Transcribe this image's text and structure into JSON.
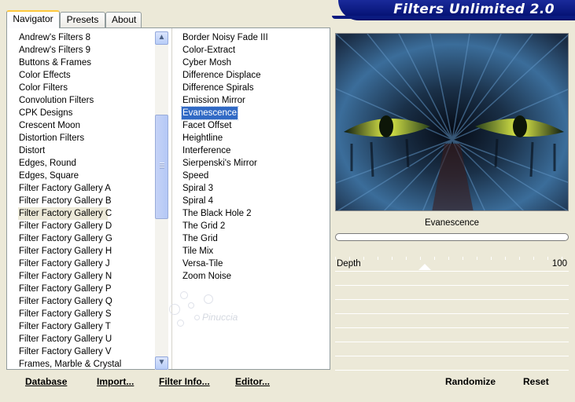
{
  "app": {
    "title": "Filters Unlimited 2.0"
  },
  "tabs": [
    {
      "label": "Navigator"
    },
    {
      "label": "Presets"
    },
    {
      "label": "About"
    }
  ],
  "categories": [
    "Andrew's Filters 8",
    "Andrew's Filters 9",
    "Buttons & Frames",
    "Color Effects",
    "Color Filters",
    "Convolution Filters",
    "CPK Designs",
    "Crescent Moon",
    "Distortion Filters",
    "Distort",
    "Edges, Round",
    "Edges, Square",
    "Filter Factory Gallery A",
    "Filter Factory Gallery B",
    "Filter Factory Gallery C",
    "Filter Factory Gallery D",
    "Filter Factory Gallery G",
    "Filter Factory Gallery H",
    "Filter Factory Gallery J",
    "Filter Factory Gallery N",
    "Filter Factory Gallery P",
    "Filter Factory Gallery Q",
    "Filter Factory Gallery S",
    "Filter Factory Gallery T",
    "Filter Factory Gallery U",
    "Filter Factory Gallery V",
    "Frames, Marble & Crystal"
  ],
  "selected_category": "Filter Factory Gallery C",
  "filters": [
    "Border Noisy Fade III",
    "Color-Extract",
    "Cyber Mosh",
    "Difference Displace",
    "Difference Spirals",
    "Emission Mirror",
    "Evanescence",
    "Facet Offset",
    "Heightline",
    "Interference",
    "Sierpenski's Mirror",
    "Speed",
    "Spiral 3",
    "Spiral 4",
    "The Black Hole 2",
    "The Grid 2",
    "The Grid",
    "Tile Mix",
    "Versa-Tile",
    "Zoom Noise"
  ],
  "selected_filter": "Evanescence",
  "watermark": {
    "text": "Pinuccia"
  },
  "bottom_buttons": [
    {
      "label": "Database"
    },
    {
      "label": "Import..."
    },
    {
      "label": "Filter Info..."
    },
    {
      "label": "Editor..."
    }
  ],
  "preview": {
    "filter_name": "Evanescence"
  },
  "parameters": [
    {
      "label": "Depth",
      "value": "100"
    }
  ],
  "right_buttons": {
    "randomize": "Randomize",
    "reset": "Reset"
  },
  "icons": {
    "scroll_up": "chevron-up-icon",
    "scroll_down": "chevron-down-icon",
    "grip": "grip-icon"
  }
}
